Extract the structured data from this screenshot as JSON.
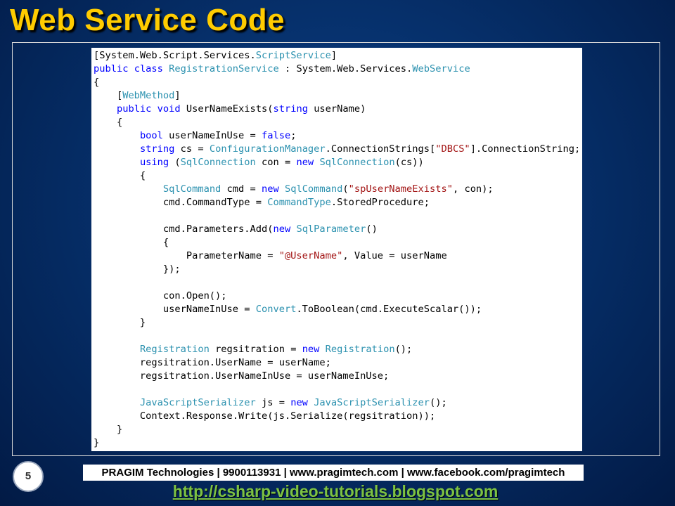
{
  "slide": {
    "title": "Web Service Code",
    "page_number": "5",
    "footer_text": "PRAGIM Technologies | 9900113931 | www.pragimtech.com | www.facebook.com/pragimtech",
    "blog_url": "http://csharp-video-tutorials.blogspot.com"
  },
  "colors": {
    "title": "#ffcc00",
    "type_name": "#2b91af",
    "keyword": "#0000ff",
    "string": "#a31515",
    "blog_link": "#7cc243"
  },
  "code_lines": [
    [
      [
        "p",
        "["
      ],
      [
        "p",
        "System.Web.Script.Services."
      ],
      [
        "t",
        "ScriptService"
      ],
      [
        "p",
        "]"
      ]
    ],
    [
      [
        "k",
        "public"
      ],
      [
        "p",
        " "
      ],
      [
        "k",
        "class"
      ],
      [
        "p",
        " "
      ],
      [
        "t",
        "RegistrationService"
      ],
      [
        "p",
        " : System.Web.Services."
      ],
      [
        "t",
        "WebService"
      ]
    ],
    [
      [
        "p",
        "{"
      ]
    ],
    [
      [
        "p",
        "    ["
      ],
      [
        "t",
        "WebMethod"
      ],
      [
        "p",
        "]"
      ]
    ],
    [
      [
        "p",
        "    "
      ],
      [
        "k",
        "public"
      ],
      [
        "p",
        " "
      ],
      [
        "k",
        "void"
      ],
      [
        "p",
        " UserNameExists("
      ],
      [
        "k",
        "string"
      ],
      [
        "p",
        " userName)"
      ]
    ],
    [
      [
        "p",
        "    {"
      ]
    ],
    [
      [
        "p",
        "        "
      ],
      [
        "k",
        "bool"
      ],
      [
        "p",
        " userNameInUse = "
      ],
      [
        "k",
        "false"
      ],
      [
        "p",
        ";"
      ]
    ],
    [
      [
        "p",
        "        "
      ],
      [
        "k",
        "string"
      ],
      [
        "p",
        " cs = "
      ],
      [
        "t",
        "ConfigurationManager"
      ],
      [
        "p",
        ".ConnectionStrings["
      ],
      [
        "s",
        "\"DBCS\""
      ],
      [
        "p",
        "].ConnectionString;"
      ]
    ],
    [
      [
        "p",
        "        "
      ],
      [
        "k",
        "using"
      ],
      [
        "p",
        " ("
      ],
      [
        "t",
        "SqlConnection"
      ],
      [
        "p",
        " con = "
      ],
      [
        "k",
        "new"
      ],
      [
        "p",
        " "
      ],
      [
        "t",
        "SqlConnection"
      ],
      [
        "p",
        "(cs))"
      ]
    ],
    [
      [
        "p",
        "        {"
      ]
    ],
    [
      [
        "p",
        "            "
      ],
      [
        "t",
        "SqlCommand"
      ],
      [
        "p",
        " cmd = "
      ],
      [
        "k",
        "new"
      ],
      [
        "p",
        " "
      ],
      [
        "t",
        "SqlCommand"
      ],
      [
        "p",
        "("
      ],
      [
        "s",
        "\"spUserNameExists\""
      ],
      [
        "p",
        ", con);"
      ]
    ],
    [
      [
        "p",
        "            cmd.CommandType = "
      ],
      [
        "t",
        "CommandType"
      ],
      [
        "p",
        ".StoredProcedure;"
      ]
    ],
    [
      [
        "p",
        ""
      ]
    ],
    [
      [
        "p",
        "            cmd.Parameters.Add("
      ],
      [
        "k",
        "new"
      ],
      [
        "p",
        " "
      ],
      [
        "t",
        "SqlParameter"
      ],
      [
        "p",
        "()"
      ]
    ],
    [
      [
        "p",
        "            {"
      ]
    ],
    [
      [
        "p",
        "                ParameterName = "
      ],
      [
        "s",
        "\"@UserName\""
      ],
      [
        "p",
        ", Value = userName"
      ]
    ],
    [
      [
        "p",
        "            });"
      ]
    ],
    [
      [
        "p",
        ""
      ]
    ],
    [
      [
        "p",
        "            con.Open();"
      ]
    ],
    [
      [
        "p",
        "            userNameInUse = "
      ],
      [
        "t",
        "Convert"
      ],
      [
        "p",
        ".ToBoolean(cmd.ExecuteScalar());"
      ]
    ],
    [
      [
        "p",
        "        }"
      ]
    ],
    [
      [
        "p",
        ""
      ]
    ],
    [
      [
        "p",
        "        "
      ],
      [
        "t",
        "Registration"
      ],
      [
        "p",
        " regsitration = "
      ],
      [
        "k",
        "new"
      ],
      [
        "p",
        " "
      ],
      [
        "t",
        "Registration"
      ],
      [
        "p",
        "();"
      ]
    ],
    [
      [
        "p",
        "        regsitration.UserName = userName;"
      ]
    ],
    [
      [
        "p",
        "        regsitration.UserNameInUse = userNameInUse;"
      ]
    ],
    [
      [
        "p",
        ""
      ]
    ],
    [
      [
        "p",
        "        "
      ],
      [
        "t",
        "JavaScriptSerializer"
      ],
      [
        "p",
        " js = "
      ],
      [
        "k",
        "new"
      ],
      [
        "p",
        " "
      ],
      [
        "t",
        "JavaScriptSerializer"
      ],
      [
        "p",
        "();"
      ]
    ],
    [
      [
        "p",
        "        Context.Response.Write(js.Serialize(regsitration));"
      ]
    ],
    [
      [
        "p",
        "    }"
      ]
    ],
    [
      [
        "p",
        "}"
      ]
    ]
  ]
}
